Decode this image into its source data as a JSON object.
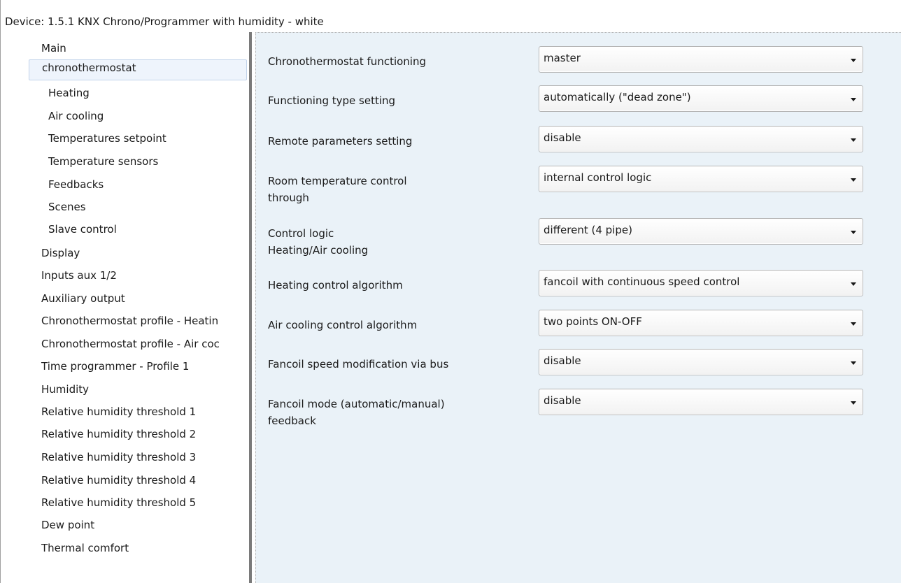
{
  "window": {
    "title": "Device: 1.5.1  KNX Chrono/Programmer with humidity - white"
  },
  "sidebar": {
    "selected_index": 1,
    "items": [
      {
        "label": "Main"
      },
      {
        "label": "chronothermostat"
      },
      {
        "label": "Heating"
      },
      {
        "label": "Air cooling"
      },
      {
        "label": "Temperatures setpoint"
      },
      {
        "label": "Temperature sensors"
      },
      {
        "label": "Feedbacks"
      },
      {
        "label": "Scenes"
      },
      {
        "label": "Slave control"
      },
      {
        "label": "Display"
      },
      {
        "label": "Inputs aux 1/2"
      },
      {
        "label": "Auxiliary output"
      },
      {
        "label": "Chronothermostat profile - Heatin"
      },
      {
        "label": "Chronothermostat profile - Air coc"
      },
      {
        "label": "Time programmer - Profile 1"
      },
      {
        "label": "Humidity"
      },
      {
        "label": "Relative humidity threshold 1"
      },
      {
        "label": "Relative humidity threshold 2"
      },
      {
        "label": "Relative humidity threshold 3"
      },
      {
        "label": "Relative humidity threshold 4"
      },
      {
        "label": "Relative humidity threshold 5"
      },
      {
        "label": "Dew point"
      },
      {
        "label": "Thermal comfort"
      }
    ]
  },
  "parameters": [
    {
      "label": "Chronothermostat functioning",
      "value": "master"
    },
    {
      "label": "Functioning type setting",
      "value": "automatically (\"dead zone\")"
    },
    {
      "label": "Remote parameters setting",
      "value": "disable"
    },
    {
      "label": "Room temperature control\n through",
      "value": "internal control logic"
    },
    {
      "label": "Control logic\nHeating/Air cooling",
      "value": "different (4 pipe)"
    },
    {
      "label": "Heating control algorithm",
      "value": "fancoil with continuous speed control"
    },
    {
      "label": "Air cooling control algorithm",
      "value": "two points ON-OFF"
    },
    {
      "label": "Fancoil speed modification via bus",
      "value": "disable"
    },
    {
      "label": "Fancoil mode (automatic/manual)\nfeedback",
      "value": "disable"
    }
  ],
  "colors": {
    "content_background": "#eaf2f8",
    "selected_item_background": "#eef4fc",
    "selected_item_border": "#c2d3ea",
    "splitter": "#7a7a7a"
  }
}
